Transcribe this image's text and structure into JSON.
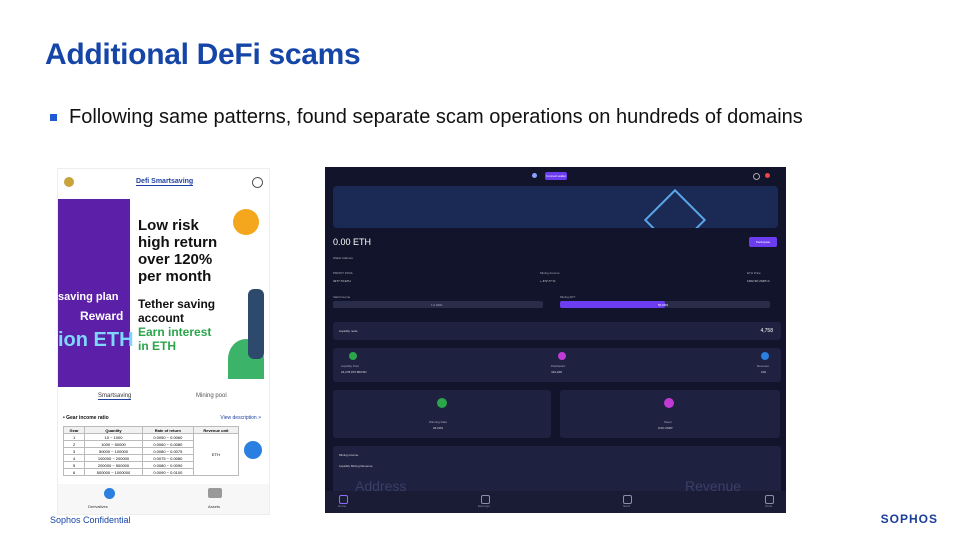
{
  "slide": {
    "title": "Additional DeFi scams",
    "bullet": "Following same patterns, found separate scam operations on hundreds of domains",
    "footer": "Sophos Confidential",
    "logo_text": "SOPHOS"
  },
  "phone": {
    "header_title": "Defi Smartsaving",
    "banner_big": [
      "Low risk",
      "high return",
      "over 120%",
      "per month"
    ],
    "banner_sub": [
      "Tether saving",
      "account",
      "Earn interest",
      "in ETH"
    ],
    "purple_lines": [
      "saving plan",
      "Reward",
      "ion ETH"
    ],
    "tabs": [
      "Smartsaving",
      "Mining pool"
    ],
    "gear_heading": "• Gear income ratio",
    "view_link": "View description >",
    "table_headers": [
      "Gear",
      "Quantity",
      "Rate of return",
      "Revenue unit"
    ],
    "table_rows": [
      [
        "1",
        "10 ~ 1000",
        "0.0050 ~ 0.0060"
      ],
      [
        "2",
        "1000 ~ 50000",
        "0.0060 ~ 0.0080"
      ],
      [
        "3",
        "50000 ~ 100000",
        "0.0080 ~ 0.0075"
      ],
      [
        "4",
        "100000 ~ 200000",
        "0.0075 ~ 0.0080"
      ],
      [
        "5",
        "200000 ~ 500000",
        "0.0080 ~ 0.0090"
      ],
      [
        "6",
        "500000 ~ 1000000",
        "0.0090 ~ 0.0100"
      ]
    ],
    "revenue_unit": "ETH",
    "bottom_nav": [
      "Derivatives",
      "Assets"
    ]
  },
  "dash": {
    "connect_btn": "Connect wallet",
    "balance": "0.00 ETH",
    "participate": "Participate",
    "wallet_label": "Wallet Address",
    "stats_labels": [
      "PROFIT POOL",
      "Mining Income",
      "ETH Price"
    ],
    "stats_values": [
      "3277.73 ETH",
      "+ 472.77 %",
      "1362.36 USDT-C"
    ],
    "bar1_label": "Valid Income",
    "bar1_value": "1.0.0001",
    "bar2_label": "Mining APY",
    "bar2_value": "50.00%",
    "liquidity_label": "Liquidity node",
    "liquidity_value": "4,758",
    "pool_labels": [
      "Liquidity Pool",
      "Participant",
      "Revenue"
    ],
    "pool_values": [
      "24,278,976.80USD",
      "419,228",
      "100"
    ],
    "card_a_label": "Winning Rate",
    "card_a_value": "26.03%",
    "card_b_label": "Saver",
    "card_b_value": "0.00 USDT",
    "mining_income": "Mining income",
    "liquidity_revenue": "Liquidity Mining Revenue",
    "watermark_left": "Address",
    "watermark_right": "Revenue",
    "nav_labels": [
      "Home",
      "Earnings",
      "Send",
      "Tools"
    ]
  }
}
